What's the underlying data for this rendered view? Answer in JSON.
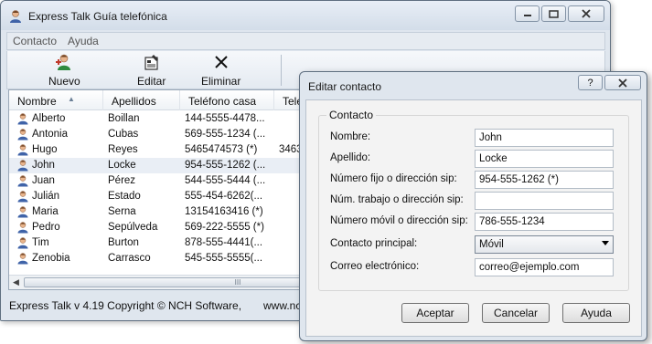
{
  "main_window": {
    "title": "Express Talk Guía telefónica",
    "menu": [
      "Contacto",
      "Ayuda"
    ],
    "toolbar": {
      "new_label": "Nuevo",
      "edit_label": "Editar",
      "delete_label": "Eliminar"
    },
    "columns": [
      "Nombre",
      "Apellidos",
      "Teléfono casa",
      "Teléfo"
    ],
    "contacts": [
      {
        "first": "Alberto",
        "last": "Boillan",
        "home": "144-5555-4478...",
        "work": ""
      },
      {
        "first": "Antonia",
        "last": "Cubas",
        "home": "569-555-1234 (...",
        "work": ""
      },
      {
        "first": "Hugo",
        "last": "Reyes",
        "home": "5465474573 (*)",
        "work": "3463"
      },
      {
        "first": "John",
        "last": "Locke",
        "home": "954-555-1262 (...",
        "work": ""
      },
      {
        "first": "Juan",
        "last": "Pérez",
        "home": "544-555-5444 (...",
        "work": ""
      },
      {
        "first": "Julián",
        "last": "Estado",
        "home": "555-454-6262(...",
        "work": ""
      },
      {
        "first": "Maria",
        "last": "Serna",
        "home": "13154163416 (*)",
        "work": ""
      },
      {
        "first": "Pedro",
        "last": "Sepúlveda",
        "home": "569-222-5555 (*)",
        "work": ""
      },
      {
        "first": "Tim",
        "last": "Burton",
        "home": "878-555-4441(...",
        "work": ""
      },
      {
        "first": "Zenobia",
        "last": "Carrasco",
        "home": "545-555-5555(...",
        "work": ""
      }
    ],
    "scrollbar_grip": "III",
    "status_text": "Express Talk v 4.19 Copyright © NCH Software,",
    "status_url": "www.nc"
  },
  "dialog": {
    "title": "Editar contacto",
    "help_glyph": "?",
    "group_title": "Contacto",
    "fields": [
      {
        "label": "Nombre:",
        "value": ""
      },
      {
        "label": "Apellido:",
        "value": ""
      },
      {
        "label": "Número fijo o dirección sip:",
        "value": ""
      },
      {
        "label": "Núm. trabajo o dirección sip:",
        "value": ""
      },
      {
        "label": "Número móvil o dirección sip:",
        "value": ""
      }
    ],
    "field_values": [
      "John",
      "Locke",
      "954-555-1262 (*)",
      "",
      "786-555-1234"
    ],
    "principal_label": "Contacto principal:",
    "principal_value": "Móvil",
    "email_label": "Correo electrónico:",
    "email_value": "correo@ejemplo.com",
    "buttons": {
      "accept": "Aceptar",
      "cancel": "Cancelar",
      "help": "Ayuda"
    }
  },
  "colors": {
    "window_frame": "#dfe6ee",
    "selection": "#e9eef5",
    "toolbar_green": "#2f8a3f"
  }
}
